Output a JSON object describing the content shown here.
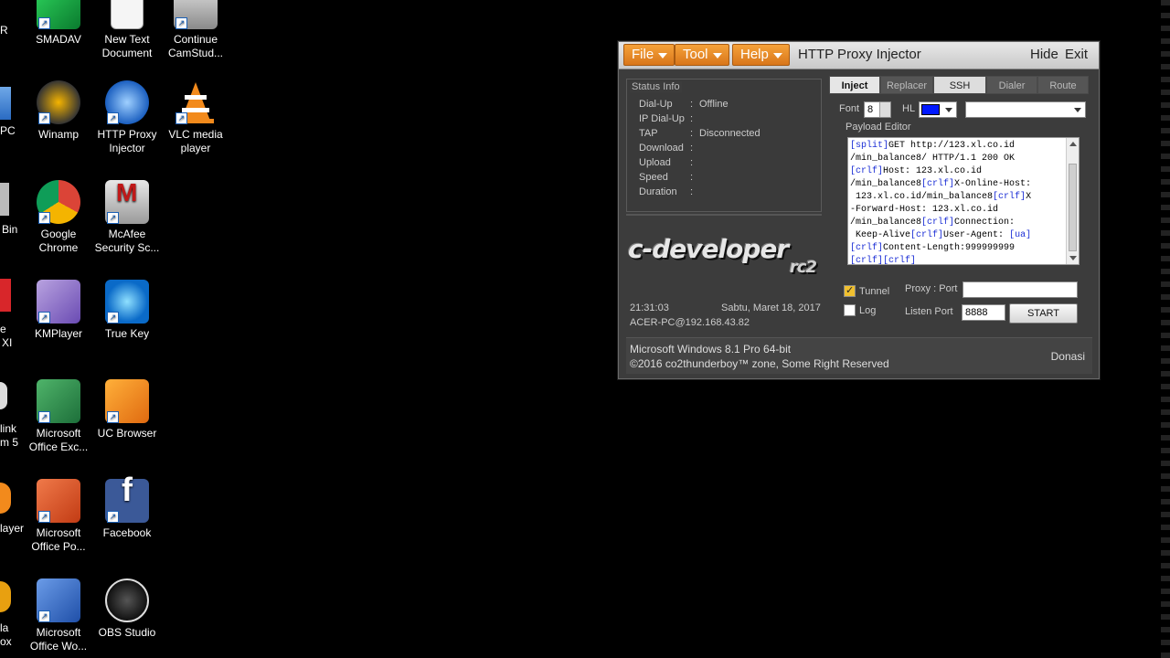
{
  "desktop": {
    "icons": [
      {
        "label": "SMADAV",
        "name": "smadav-icon"
      },
      {
        "label": "New Text\nDocument",
        "name": "text-document-icon"
      },
      {
        "label": "Continue\nCamStud...",
        "name": "camstudio-icon"
      },
      {
        "label": "Winamp",
        "name": "winamp-icon"
      },
      {
        "label": "HTTP Proxy\nInjector",
        "name": "http-proxy-injector-icon"
      },
      {
        "label": "VLC media\nplayer",
        "name": "vlc-icon"
      },
      {
        "label": "Google\nChrome",
        "name": "chrome-icon"
      },
      {
        "label": "McAfee\nSecurity Sc...",
        "name": "mcafee-icon"
      },
      {
        "label": "KMPlayer",
        "name": "kmplayer-icon"
      },
      {
        "label": "True Key",
        "name": "truekey-icon"
      },
      {
        "label": "Microsoft\nOffice Exc...",
        "name": "excel-icon"
      },
      {
        "label": "UC Browser",
        "name": "ucbrowser-icon"
      },
      {
        "label": "Microsoft\nOffice Po...",
        "name": "powerpoint-icon"
      },
      {
        "label": "Facebook",
        "name": "facebook-icon"
      },
      {
        "label": "Microsoft\nOffice Wo...",
        "name": "word-icon"
      },
      {
        "label": "OBS Studio",
        "name": "obs-icon"
      }
    ],
    "cut_labels": [
      "R",
      "PC",
      "Bin",
      "e",
      "XI",
      "link",
      "m 5",
      "layer",
      "la",
      "ox"
    ]
  },
  "window": {
    "menu": {
      "file": "File",
      "tool": "Tool",
      "help": "Help"
    },
    "title": "HTTP Proxy Injector",
    "hide": "Hide",
    "exit": "Exit",
    "status": {
      "legend": "Status Info",
      "rows": [
        {
          "key": "Dial-Up",
          "value": "Offline"
        },
        {
          "key": "IP Dial-Up",
          "value": ""
        },
        {
          "key": "TAP",
          "value": "Disconnected"
        },
        {
          "key": "Download",
          "value": ""
        },
        {
          "key": "Upload",
          "value": ""
        },
        {
          "key": "Speed",
          "value": ""
        },
        {
          "key": "Duration",
          "value": ""
        }
      ],
      "separator": ":"
    },
    "logo": {
      "main": "c-developer",
      "sub": "rc2"
    },
    "clock": "21:31:03",
    "date": "Sabtu, Maret 18, 2017",
    "host": "ACER-PC@192.168.43.82",
    "tabs": [
      "Inject",
      "Replacer",
      "SSH",
      "Dialer",
      "Route"
    ],
    "inject": {
      "font_label": "Font",
      "font_value": "8",
      "hl_label": "HL",
      "hl_color": "#0018ff",
      "payload_legend": "Payload Editor",
      "payload_lines": [
        [
          [
            "tag",
            "[split]"
          ],
          [
            "txt",
            "GET http://123.xl.co.id"
          ]
        ],
        [
          [
            "txt",
            "/min_balance8/ HTTP/1.1 200 OK"
          ]
        ],
        [
          [
            "tag",
            "[crlf]"
          ],
          [
            "txt",
            "Host: 123.xl.co.id"
          ]
        ],
        [
          [
            "txt",
            "/min_balance8"
          ],
          [
            "tag",
            "[crlf]"
          ],
          [
            "txt",
            "X-Online-Host:"
          ]
        ],
        [
          [
            "txt",
            " 123.xl.co.id/min_balance8"
          ],
          [
            "tag",
            "[crlf]"
          ],
          [
            "txt",
            "X"
          ]
        ],
        [
          [
            "txt",
            "-Forward-Host: 123.xl.co.id"
          ]
        ],
        [
          [
            "txt",
            "/min_balance8"
          ],
          [
            "tag",
            "[crlf]"
          ],
          [
            "txt",
            "Connection:"
          ]
        ],
        [
          [
            "txt",
            " Keep-Alive"
          ],
          [
            "tag",
            "[crlf]"
          ],
          [
            "txt",
            "User-Agent: "
          ],
          [
            "tag",
            "[ua]"
          ]
        ],
        [
          [
            "tag",
            "[crlf]"
          ],
          [
            "txt",
            "Content-Length:999999999"
          ]
        ],
        [
          [
            "tag",
            "[crlf][crlf]"
          ]
        ]
      ],
      "tunnel_label": "Tunnel",
      "tunnel_checked": true,
      "log_label": "Log",
      "log_checked": false,
      "proxy_port_label": "Proxy : Port",
      "proxy_port_value": "",
      "listen_port_label": "Listen Port",
      "listen_port_value": "8888",
      "start_label": "START"
    },
    "footer": {
      "os": "Microsoft Windows 8.1 Pro 64-bit",
      "copyright": "©2016 co2thunderboy™ zone, Some Right Reserved",
      "donasi": "Donasi"
    }
  }
}
